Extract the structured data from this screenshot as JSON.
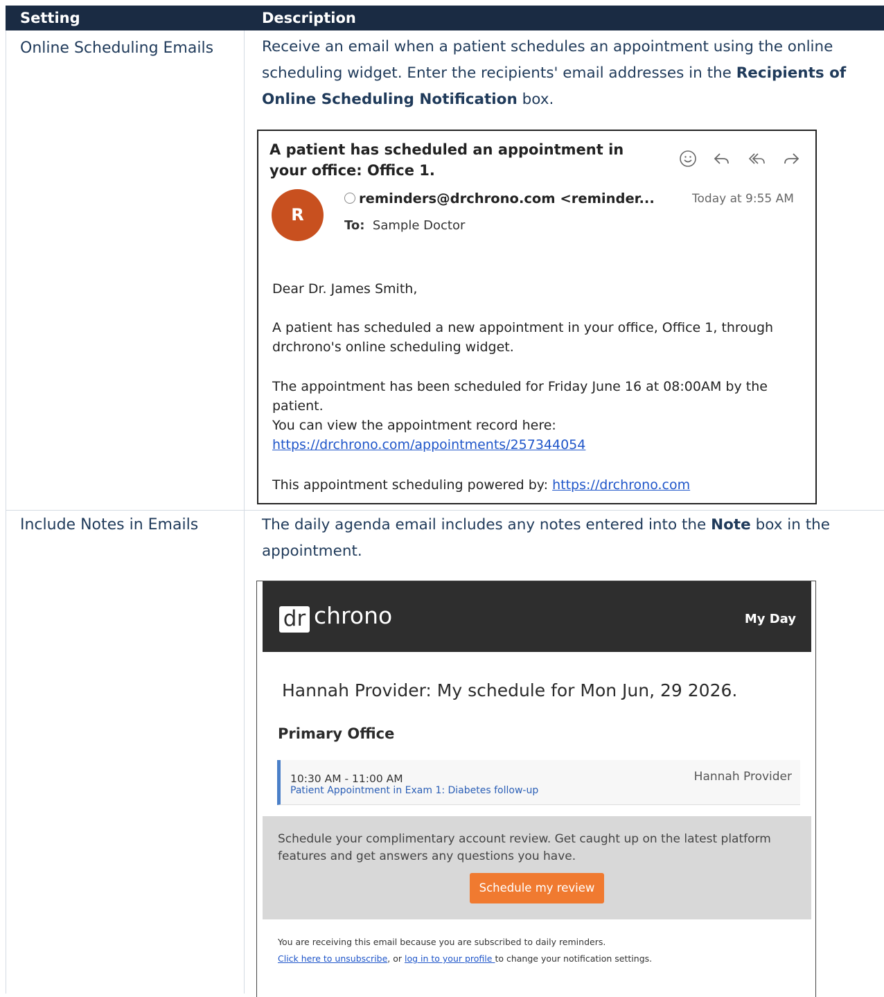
{
  "table": {
    "headers": [
      "Setting",
      "Description"
    ],
    "rows": [
      {
        "setting": "Online Scheduling Emails",
        "desc_part1": "Receive an email when a patient schedules an appointment using the online scheduling widget. Enter the recipients' email addresses in the ",
        "desc_bold": "Recipients of Online Scheduling Notification",
        "desc_part2": " box."
      },
      {
        "setting": "Include Notes in Emails",
        "desc_part1": "The daily agenda email includes any notes entered into the ",
        "desc_bold": "Note",
        "desc_part2": " box in the appointment."
      }
    ]
  },
  "email1": {
    "subject": "A patient has scheduled an appointment in your office: Office 1.",
    "avatar_letter": "R",
    "sender": "reminders@drchrono.com <reminder...",
    "to_label": "To:",
    "to_value": "Sample Doctor",
    "timestamp": "Today at 9:55 AM",
    "icons": [
      "smiley-icon",
      "reply-icon",
      "reply-all-icon",
      "forward-icon"
    ],
    "greeting": "Dear Dr. James Smith,",
    "para1": "A patient has scheduled a new appointment in your office, Office 1, through drchrono's online scheduling widget.",
    "para2": "The appointment has been scheduled for Friday June 16 at 08:00AM by the patient.",
    "para3": "You can view the appointment record here:",
    "record_link": "https://drchrono.com/appointments/257344054",
    "powered_label": "This appointment scheduling powered by:",
    "powered_link": "https://drchrono.com"
  },
  "email2": {
    "logo_box": "dr",
    "logo_text": "chrono",
    "my_day": "My Day",
    "schedule_title": "Hannah Provider: My schedule for Mon Jun, 29 2026.",
    "office": "Primary Office",
    "appt_time": "10:30 AM - 11:00 AM",
    "appt_desc": "Patient Appointment in Exam 1: Diabetes follow-up",
    "appt_provider": "Hannah Provider",
    "promo_text": "Schedule your complimentary account review. Get caught up on the latest platform features and get answers any questions you have.",
    "promo_button": "Schedule my review",
    "footer_line1": "You are receiving this email because you are subscribed to daily reminders.",
    "unsubscribe_link": "Click here to unsubscribe",
    "footer_mid": ", or ",
    "login_link": "log in to your profile ",
    "footer_end": "to change your notification settings."
  },
  "colors": {
    "header_bg": "#1a2b43",
    "text": "#1f3a5a",
    "avatar": "#c8501f",
    "promo_button": "#f07a30",
    "link": "#1e55c9"
  }
}
